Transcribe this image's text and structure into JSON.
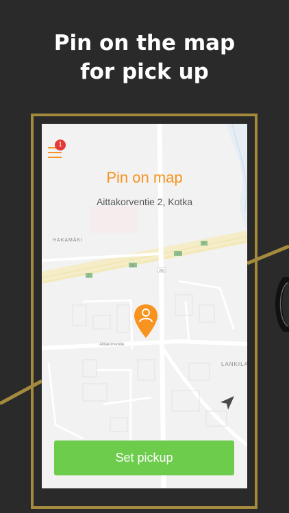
{
  "headline": {
    "line1": "Pin on the map",
    "line2": "for pick up"
  },
  "app": {
    "menu": {
      "icon": "hamburger-menu-icon",
      "badge_count": "1"
    },
    "title": "Pin on map",
    "address": "Aittakorventie 2, Kotka",
    "map": {
      "labels": {
        "district_hakamaki": "HAKAMÄKI",
        "district_lankila": "LANKILA",
        "street_aittakorventie": "Aittakorventie",
        "road_15": "15",
        "road_7": "7",
        "road_7b": "7",
        "road_15b": "15",
        "road_350": "350"
      },
      "pin_icon": "person-pin-icon",
      "location_icon": "navigation-arrow-icon"
    },
    "pickup_button_label": "Set pickup"
  },
  "colors": {
    "accent": "#f7931e",
    "button_green": "#6dcc4c",
    "frame_gold": "#a48a3c",
    "background": "#2a2a2a",
    "badge_red": "#e53935"
  }
}
